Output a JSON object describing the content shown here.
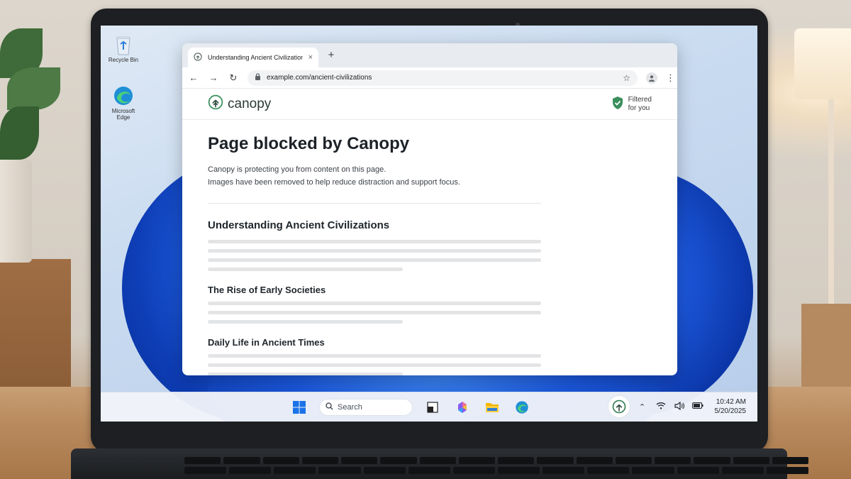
{
  "desktop": {
    "icons": [
      {
        "label": "Recycle Bin"
      },
      {
        "label": "Microsoft Edge"
      }
    ]
  },
  "browser": {
    "tab": {
      "title": "Understanding Ancient Civilizations",
      "close": "×"
    },
    "new_tab": "+",
    "toolbar": {
      "back": "←",
      "forward": "→",
      "reload": "↻",
      "url": "example.com/ancient-civilizations",
      "star": "☆",
      "menu": "⋮"
    }
  },
  "canopy": {
    "brand": "canopy",
    "badge_line1": "Filtered",
    "badge_line2": "for you",
    "accent": "#3a8f5c"
  },
  "page": {
    "title": "Page blocked by Canopy",
    "desc_line1": "Canopy is protecting you from content on this page.",
    "desc_line2": "Images have been removed to help reduce distraction and support focus.",
    "section_title": "Understanding Ancient Civilizations",
    "sub1": "The Rise of Early Societies",
    "sub2": "Daily Life in Ancient Times"
  },
  "taskbar": {
    "search_placeholder": "Search",
    "tray_chevron": "⌃",
    "time": "10:42 AM",
    "date": "5/20/2025"
  }
}
